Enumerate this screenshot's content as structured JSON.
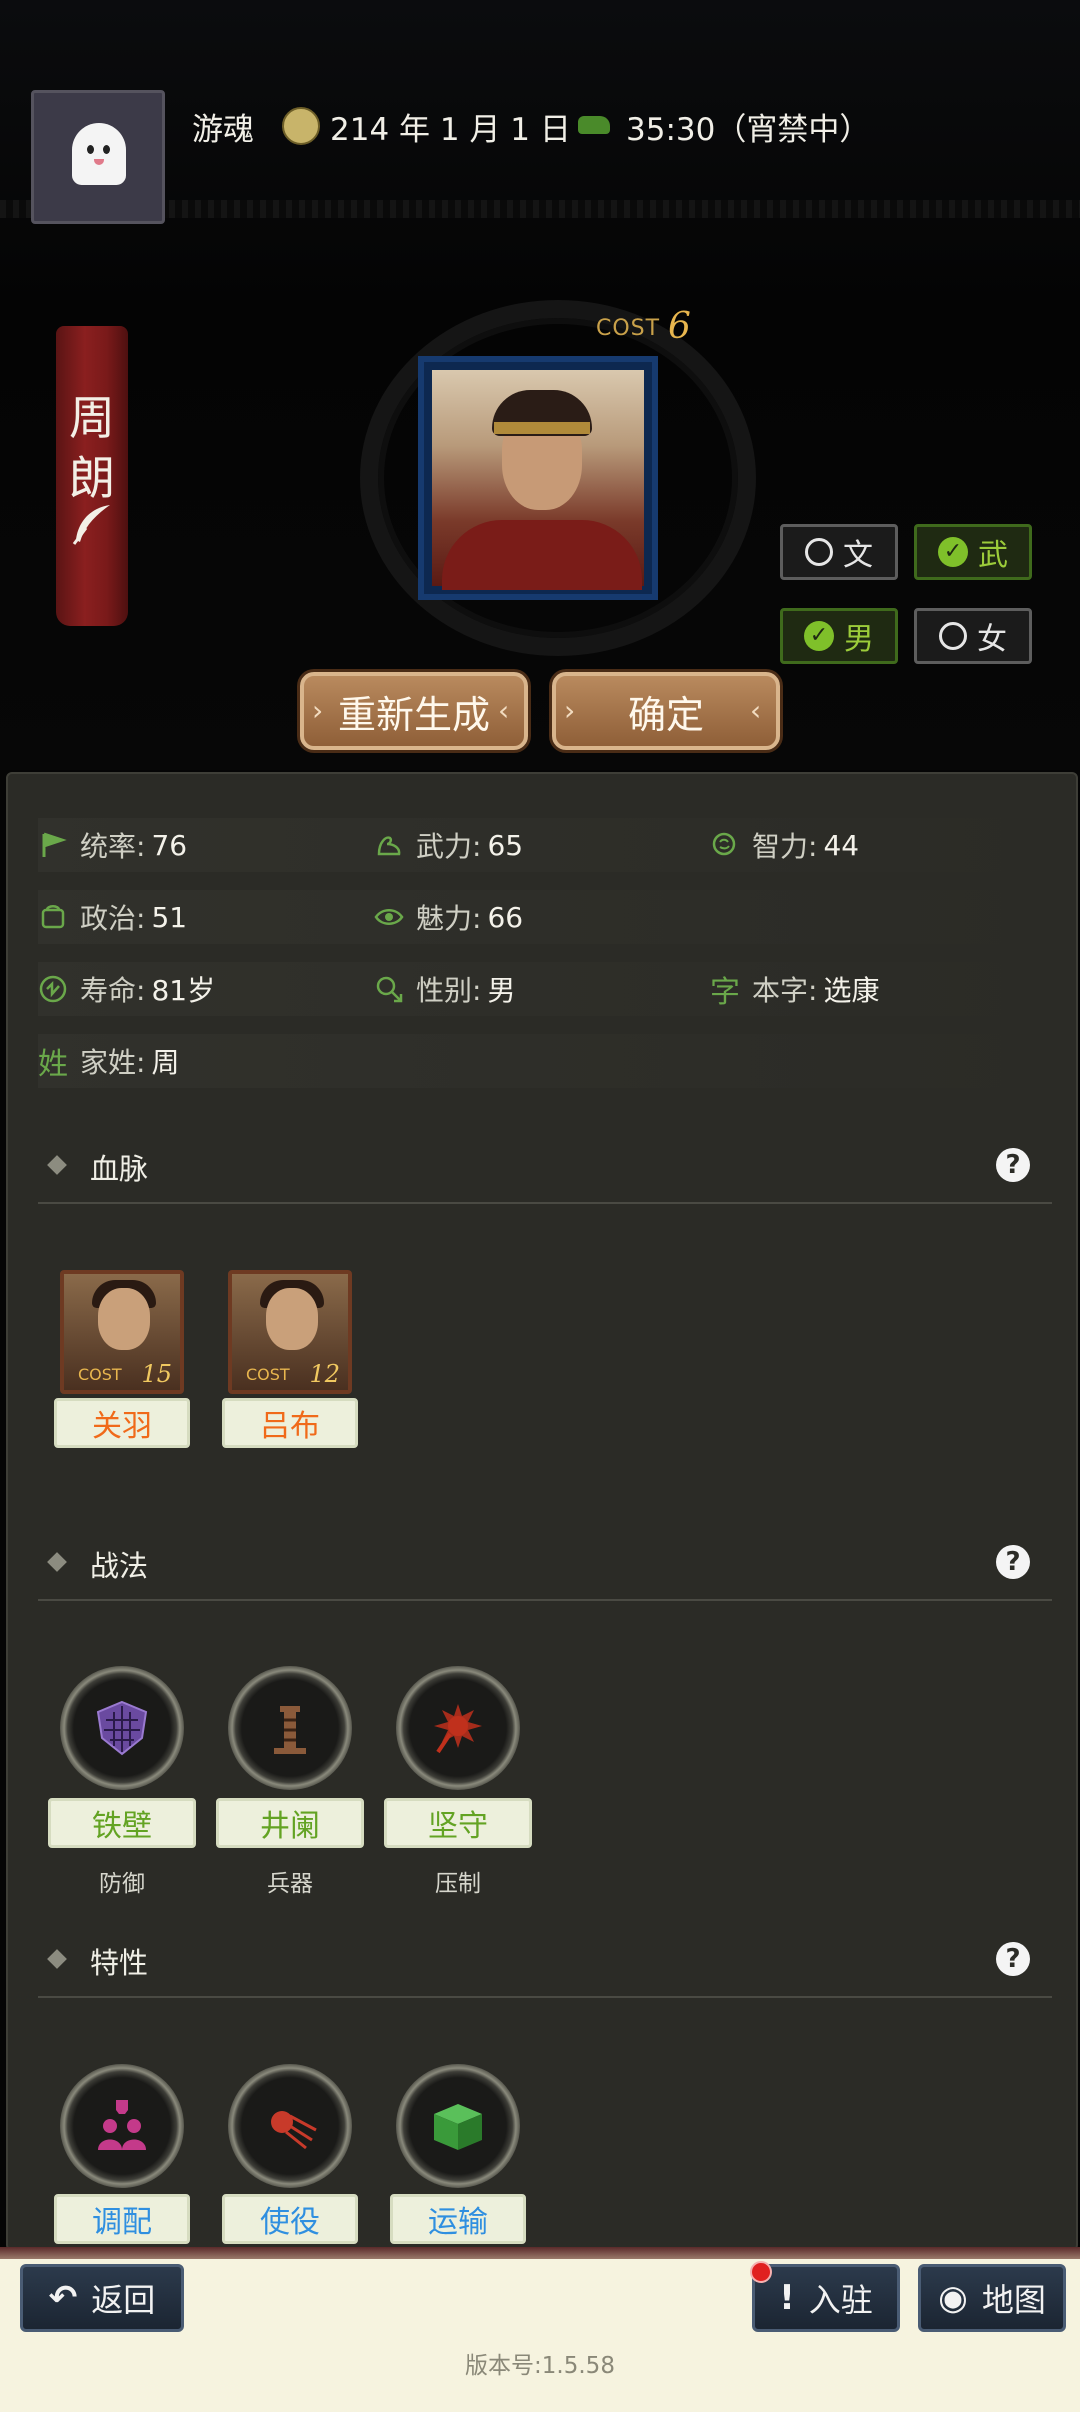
{
  "header": {
    "user_name": "游魂",
    "date": "214 年 1 月 1 日",
    "time": "35:30（宵禁中）"
  },
  "character": {
    "name_chars": [
      "周",
      "朗"
    ],
    "cost_label": "COST",
    "cost_value": "6"
  },
  "toggles": {
    "wen": {
      "label": "文",
      "checked": false
    },
    "wu": {
      "label": "武",
      "checked": true
    },
    "male": {
      "label": "男",
      "checked": true
    },
    "female": {
      "label": "女",
      "checked": false
    }
  },
  "actions": {
    "regenerate": "重新生成",
    "confirm": "确定"
  },
  "stats": [
    {
      "label": "统率:",
      "value": "76",
      "icon": "flag-icon"
    },
    {
      "label": "武力:",
      "value": "65",
      "icon": "arm-icon"
    },
    {
      "label": "智力:",
      "value": "44",
      "icon": "brain-icon"
    },
    {
      "label": "政治:",
      "value": "51",
      "icon": "document-icon"
    },
    {
      "label": "魅力:",
      "value": "66",
      "icon": "eye-icon"
    },
    {
      "label": "寿命:",
      "value": "81岁",
      "icon": "lifespan-icon"
    },
    {
      "label": "性别:",
      "value": "男",
      "icon": "gender-icon"
    },
    {
      "label": "本字:",
      "value": "选康",
      "icon_char": "字"
    },
    {
      "label": "家姓:",
      "value": "周",
      "icon_char": "姓"
    }
  ],
  "sections": {
    "bloodline": {
      "title": "血脉",
      "items": [
        {
          "name": "关羽",
          "cost_label": "COST",
          "cost": "15"
        },
        {
          "name": "吕布",
          "cost_label": "COST",
          "cost": "12"
        }
      ]
    },
    "tactics": {
      "title": "战法",
      "items": [
        {
          "name": "铁壁",
          "type": "防御",
          "icon": "shield-hex-icon",
          "color": "#6a4aa0"
        },
        {
          "name": "井阑",
          "type": "兵器",
          "icon": "siege-tower-icon",
          "color": "#8a5a3a"
        },
        {
          "name": "坚守",
          "type": "压制",
          "icon": "fire-emblem-icon",
          "color": "#c0301c"
        }
      ]
    },
    "traits": {
      "title": "特性",
      "items": [
        {
          "name": "调配",
          "icon": "people-bulb-icon",
          "color": "#c43a8a"
        },
        {
          "name": "使役",
          "icon": "comet-icon",
          "color": "#c83a2a"
        },
        {
          "name": "运输",
          "icon": "box-icon",
          "color": "#3a9a3a"
        }
      ]
    }
  },
  "bottom_bar": {
    "back": "返回",
    "settle": "入驻",
    "map": "地图",
    "version": "版本号:1.5.58"
  }
}
